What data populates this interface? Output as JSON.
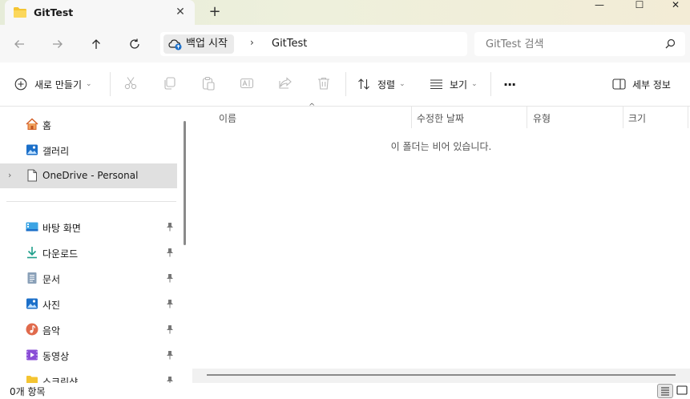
{
  "window": {
    "tab_title": "GitTest",
    "tab_close": "✕",
    "new_tab": "+",
    "minimize": "—",
    "maximize": "☐",
    "close": "✕"
  },
  "address": {
    "crumbs": [
      "백업 시작",
      "GitTest"
    ],
    "separator": "›",
    "search_placeholder": "GitTest 검색"
  },
  "toolbar": {
    "new_label": "새로 만들기",
    "sort_label": "정렬",
    "view_label": "보기",
    "more_label": "···",
    "details_label": "세부 정보"
  },
  "sidebar": {
    "items": [
      {
        "label": "홈",
        "icon": "home-icon"
      },
      {
        "label": "갤러리",
        "icon": "gallery-icon"
      },
      {
        "label": "OneDrive - Personal",
        "icon": "document-icon",
        "expander": "›"
      },
      {
        "label": "바탕 화면",
        "icon": "desktop-icon"
      },
      {
        "label": "다운로드",
        "icon": "download-icon"
      },
      {
        "label": "문서",
        "icon": "documents-icon"
      },
      {
        "label": "사진",
        "icon": "pictures-icon"
      },
      {
        "label": "음악",
        "icon": "music-icon"
      },
      {
        "label": "동영상",
        "icon": "videos-icon"
      },
      {
        "label": "스크린샷",
        "icon": "folder-icon"
      }
    ]
  },
  "content": {
    "columns": [
      "이름",
      "수정한 날짜",
      "유형",
      "크기"
    ],
    "sort_indicator": "^",
    "empty_message": "이 폴더는 비어 있습니다."
  },
  "status": {
    "item_count": "0개 항목"
  },
  "colors": {
    "title_bar": "#e9eed9",
    "selected": "#e0e0e0",
    "accent_blue": "#1b6fc9",
    "folder_yellow": "#f4c431"
  }
}
